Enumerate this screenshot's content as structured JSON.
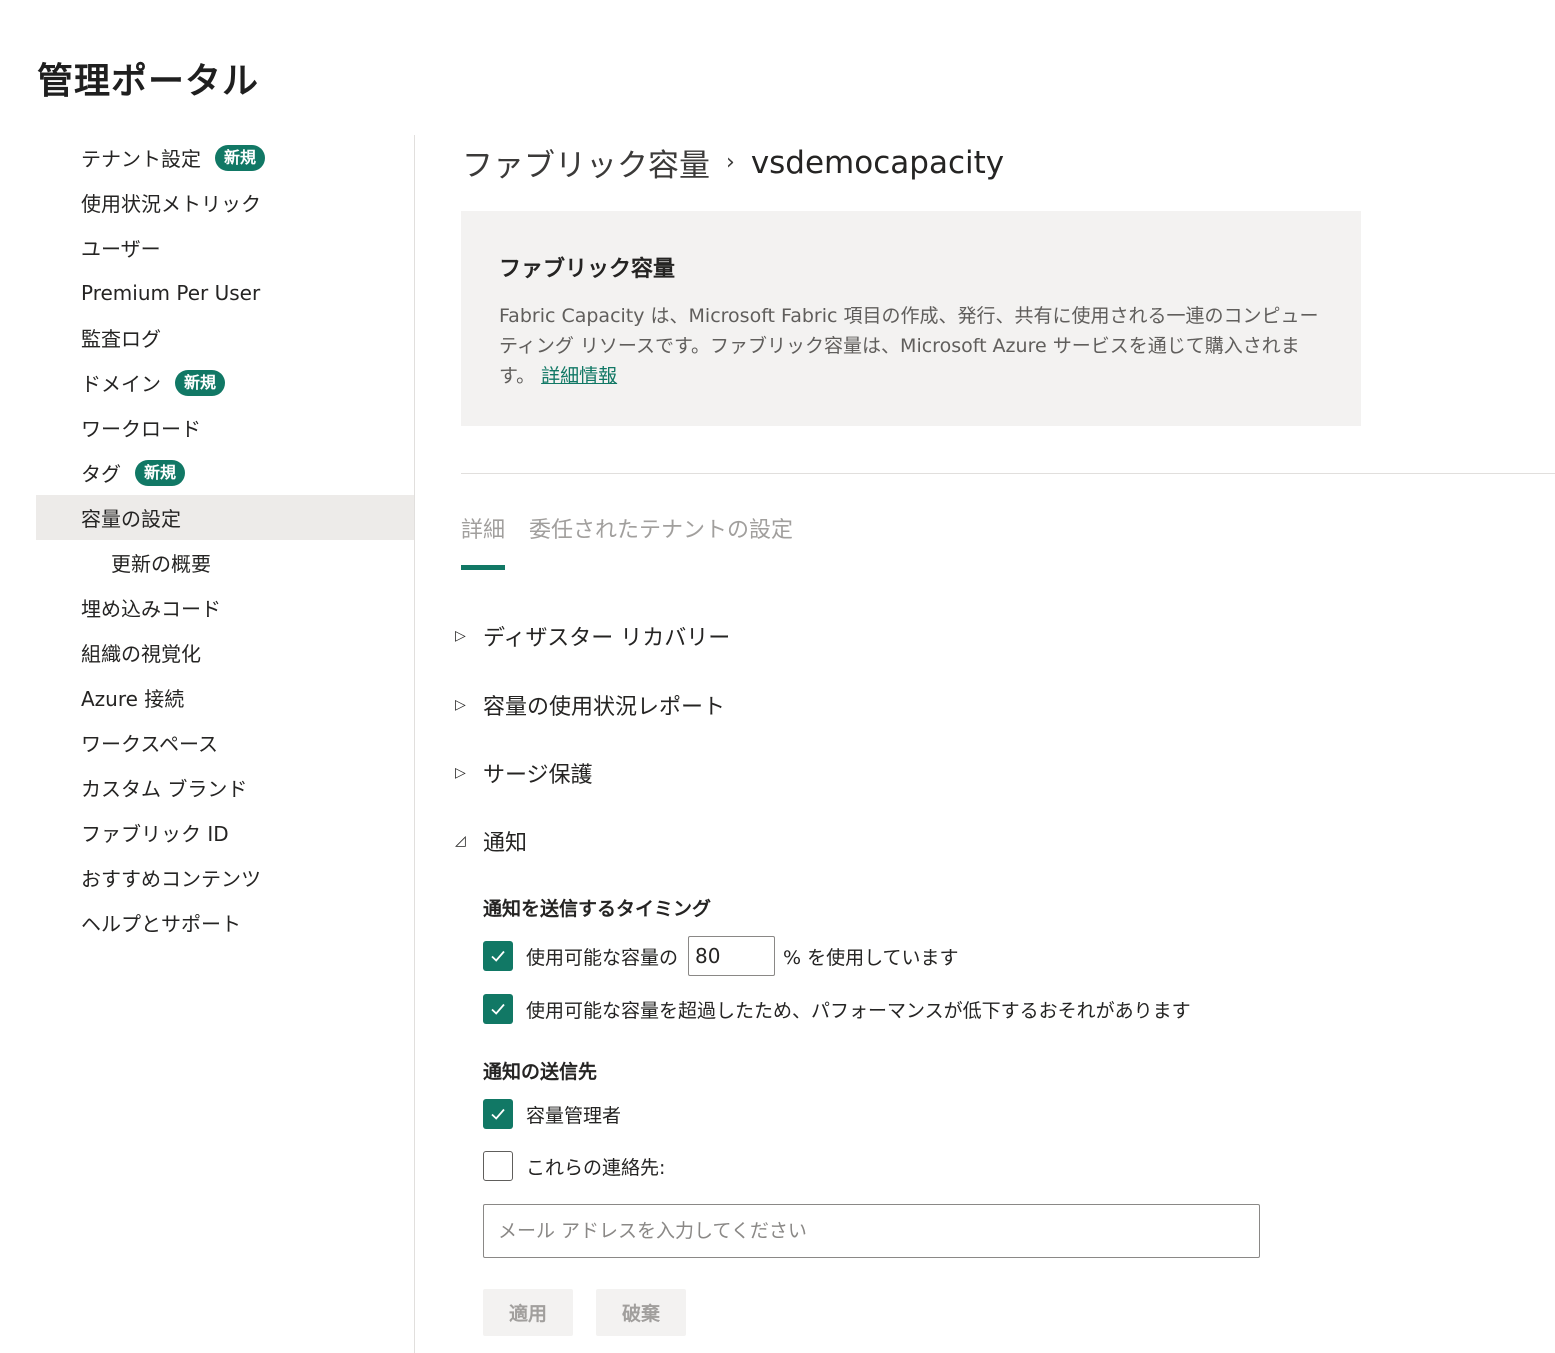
{
  "page": {
    "title": "管理ポータル"
  },
  "sidebar": {
    "badge_new": "新規",
    "items": [
      {
        "label": "テナント設定",
        "badge": true
      },
      {
        "label": "使用状況メトリック"
      },
      {
        "label": "ユーザー"
      },
      {
        "label": "Premium Per User"
      },
      {
        "label": "監査ログ"
      },
      {
        "label": "ドメイン",
        "badge": true
      },
      {
        "label": "ワークロード"
      },
      {
        "label": "タグ",
        "badge": true
      },
      {
        "label": "容量の設定",
        "selected": true
      },
      {
        "label": "更新の概要",
        "sub": true
      },
      {
        "label": "埋め込みコード"
      },
      {
        "label": "組織の視覚化"
      },
      {
        "label": "Azure 接続"
      },
      {
        "label": "ワークスペース"
      },
      {
        "label": "カスタム ブランド"
      },
      {
        "label": "ファブリック ID"
      },
      {
        "label": "おすすめコンテンツ"
      },
      {
        "label": "ヘルプとサポート"
      }
    ]
  },
  "breadcrumb": {
    "parent": "ファブリック容量",
    "current": "vsdemocapacity"
  },
  "info": {
    "title": "ファブリック容量",
    "description": "Fabric Capacity は、Microsoft Fabric 項目の作成、発行、共有に使用される一連のコンピューティング リソースです。ファブリック容量は、Microsoft Azure サービスを通じて購入されます。",
    "link": "詳細情報"
  },
  "tabs": [
    {
      "label": "詳細",
      "active": true
    },
    {
      "label": "委任されたテナントの設定"
    }
  ],
  "sections": {
    "disaster_recovery": "ディザスター リカバリー",
    "usage_report": "容量の使用状況レポート",
    "surge_protection": "サージ保護",
    "notifications": "通知"
  },
  "notifications": {
    "timing_title": "通知を送信するタイミング",
    "usage_prefix": "使用可能な容量の",
    "usage_value": "80",
    "usage_suffix": "% を使用しています",
    "exceed_label": "使用可能な容量を超過したため、パフォーマンスが低下するおそれがあります",
    "recipients_title": "通知の送信先",
    "admin_label": "容量管理者",
    "contacts_label": "これらの連絡先:",
    "email_placeholder": "メール アドレスを入力してください"
  },
  "buttons": {
    "apply": "適用",
    "discard": "破棄"
  }
}
